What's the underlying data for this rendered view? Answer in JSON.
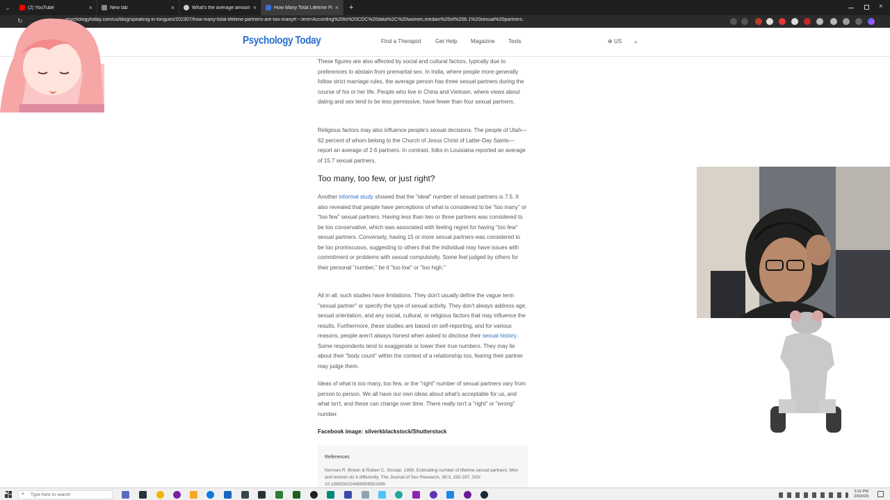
{
  "browser": {
    "tabs": [
      {
        "title": "(2) YouTube",
        "color": "#ff0000",
        "active": false
      },
      {
        "title": "New tab",
        "color": "#888888",
        "active": false
      },
      {
        "title": "What's the average amount of m...",
        "color": "#cccccc",
        "active": false
      },
      {
        "title": "How Many Total Lifetime Partners...",
        "color": "#3b6fd6",
        "active": true
      }
    ],
    "new_tab": "+",
    "url": "psychologytoday.com/us/blog/speaking-in-tongues/202307/how-many-total-lifetime-partners-are-too-many#:~:text=According%20to%20CDC%20data%2C%20women,median%20of%206.1%20sexual%20partners."
  },
  "site": {
    "logo": "Psychology Today",
    "nav": [
      "Find a Therapist",
      "Get Help",
      "Magazine",
      "Tests"
    ],
    "region": "US",
    "accent": "#2a6fd1"
  },
  "article": {
    "p1": "These figures are also affected by social and cultural factors, typically due to preferences to abstain from premarital sex. In India, where people more generally follow strict marriage rules, the average person has three sexual partners during the course of his or her life. People who live in China and Vietnam, where views about dating and sex tend to be less permissive, have fewer than four sexual partners.",
    "p2": "Religious factors may also influence people's sexual decisions. The people of Utah—62 percent of whom belong to the Church of Jesus Christ of Latter-Day Saints—report an average of 2.6 partners. In contrast, folks in Louisiana reported an average of 15.7 sexual partners.",
    "heading": "Too many, too few, or just right?",
    "p3_pre": "Another ",
    "p3_link": "informal study",
    "p3_post": " showed that the \"ideal\" number of sexual partners is 7.5. It also revealed that people have perceptions of what is considered to be \"too many\" or \"too few\" sexual partners. Having less than two or three partners was considered to be too conservative, which was associated with feeling regret for having \"too few\" sexual partners. Conversely, having 15 or more sexual partners was considered to be too promiscuous, suggesting to others that the individual may have issues with commitment or problems with sexual compulsivity. Some feel judged by others for their personal \"number,\" be it \"too low\" or \"too high.\"",
    "p4_pre": "All in all, such studies have limitations. They don't usually define the vague term \"sexual partner\" or specify the type of sexual activity. They don't always address age, sexual orientation, and any social, cultural, or religious factors that may influence the results. Furthermore, these studies are based on self-reporting, and for various reasons, people aren't always honest when asked to disclose their ",
    "p4_link": "sexual history",
    "p4_post": ". Some respondents tend to exaggerate or lower their true numbers. They may lie about their \"body count\" within the context of a relationship too, fearing their partner may judge them.",
    "p5": "Ideas of what is too many, too few, or the \"right\" number of sexual partners vary from person to person. We all have our own ideas about what's acceptable for us, and what isn't, and these can change over time. There really isn't a \"right\" or \"wrong\" number.",
    "fb_image": "Facebook image: silverkblackstock/Shutterstock",
    "references_title": "References",
    "reference_1": "Norman R. Brown & Robert C. Sinclair. 1999. Estimating number of lifetime sexual partners: Men and women do it differently. The Journal of Sex Research, 36:3, 292-297, DOI: 10.1080/00224499909551999"
  },
  "taskbar": {
    "search_placeholder": "Type here to search",
    "time": "3:15 PM",
    "date": "2/9/2025"
  }
}
